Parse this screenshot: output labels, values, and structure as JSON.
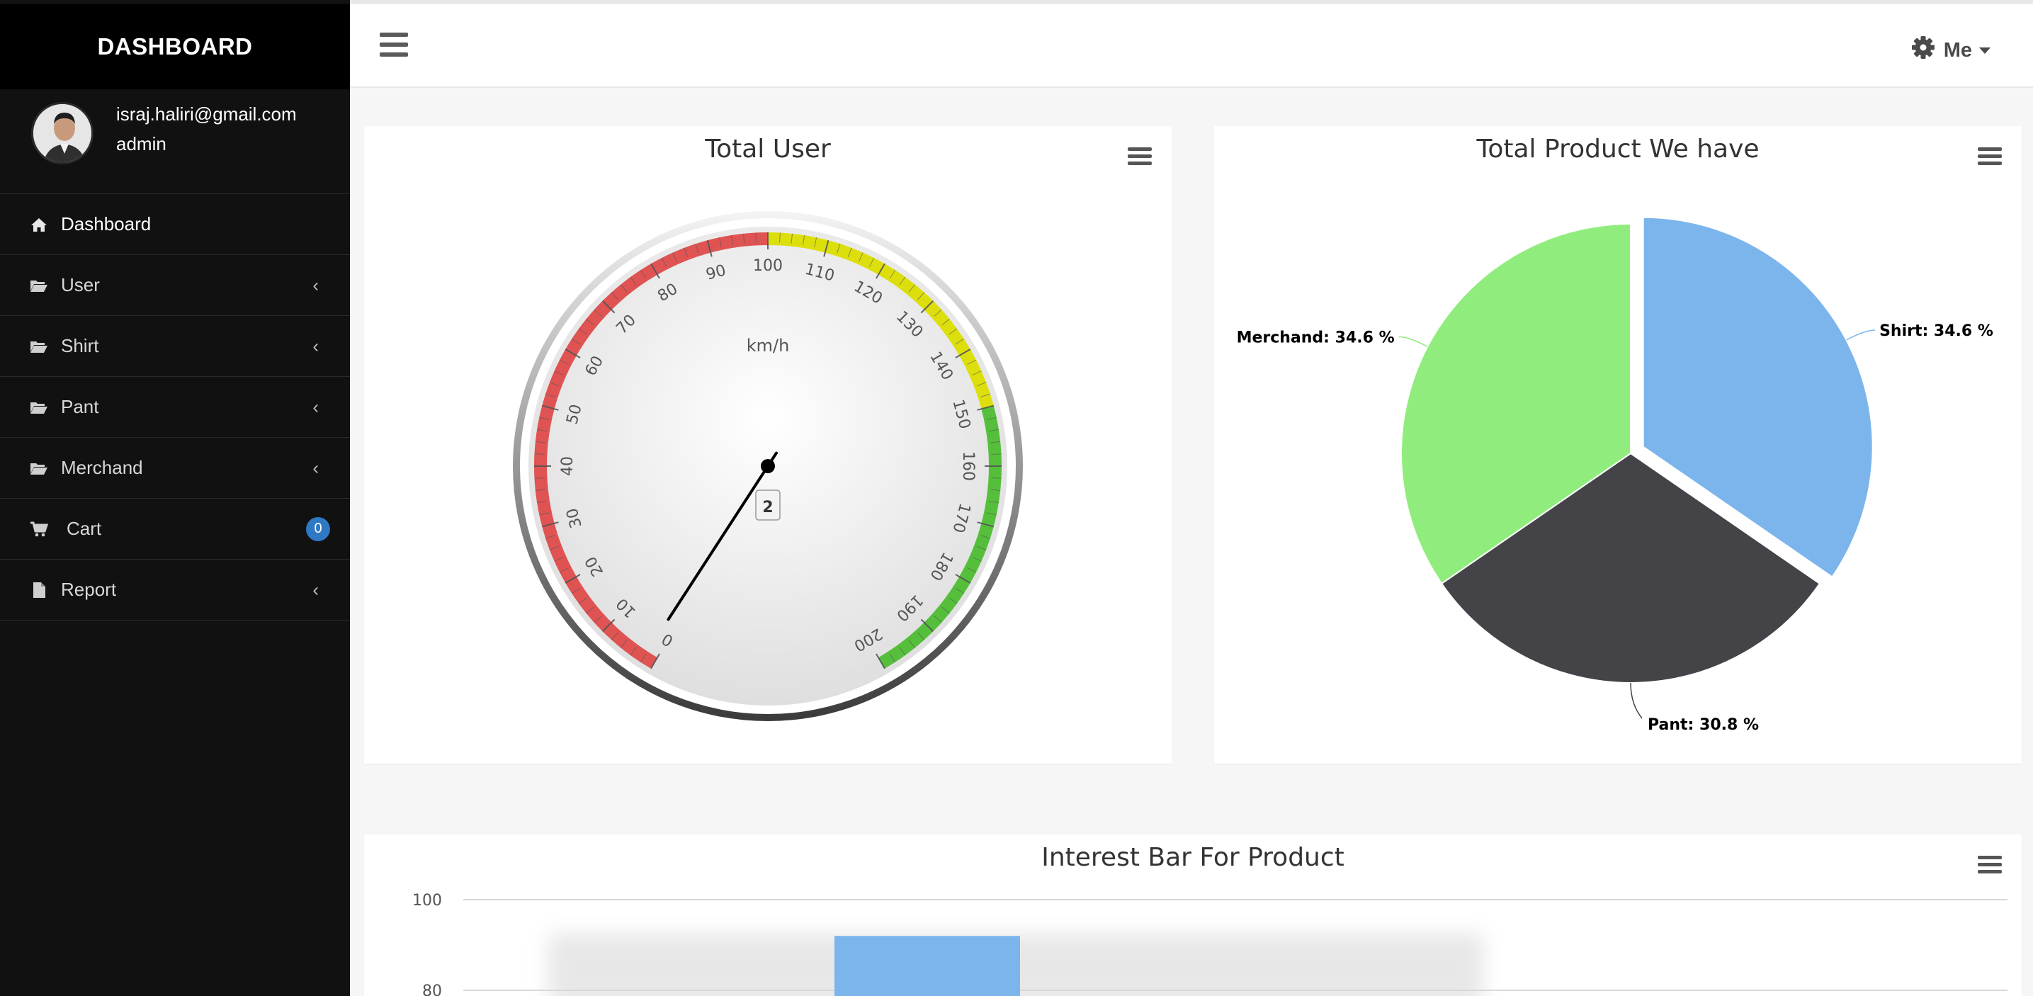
{
  "sidebar": {
    "brand": "DASHBOARD",
    "profile": {
      "email": "israj.haliri@gmail.com",
      "role": "admin"
    },
    "items": [
      {
        "label": "Dashboard",
        "icon": "home-icon",
        "active": true
      },
      {
        "label": "User",
        "icon": "folder-open-icon"
      },
      {
        "label": "Shirt",
        "icon": "folder-open-icon"
      },
      {
        "label": "Pant",
        "icon": "folder-open-icon"
      },
      {
        "label": "Merchand",
        "icon": "folder-open-icon"
      },
      {
        "label": "Cart",
        "icon": "cart-icon",
        "badge": "0"
      },
      {
        "label": "Report",
        "icon": "file-icon"
      }
    ]
  },
  "topbar": {
    "user_label": "Me",
    "menu_icon": "hamburger-icon",
    "settings_icon": "gear-icon"
  },
  "colors": {
    "sidebar_bg": "#111111",
    "brand_bg": "#000000",
    "badge": "#2f78c4",
    "gauge_red": "#df5353",
    "gauge_yellow": "#dddf0d",
    "gauge_green": "#55bf3b",
    "pie_shirt": "#7cb5ec",
    "pie_pant": "#434348",
    "pie_merchand": "#90ed7d",
    "bar": "#7cb5ec"
  },
  "chart_data": [
    {
      "type": "gauge",
      "title": "Total User",
      "unit": "km/h",
      "min": 0,
      "max": 200,
      "ticks": [
        0,
        10,
        20,
        30,
        40,
        50,
        60,
        70,
        80,
        90,
        100,
        110,
        120,
        130,
        140,
        150,
        160,
        170,
        180,
        190,
        200
      ],
      "bands": [
        {
          "from": 0,
          "to": 100,
          "color": "red"
        },
        {
          "from": 100,
          "to": 150,
          "color": "yellow"
        },
        {
          "from": 150,
          "to": 200,
          "color": "green"
        }
      ],
      "value": 2,
      "value_label": "2"
    },
    {
      "type": "pie",
      "title": "Total Product We have",
      "slices": [
        {
          "name": "Shirt",
          "value": 34.6,
          "label": "Shirt: 34.6 %",
          "sliced": true
        },
        {
          "name": "Pant",
          "value": 30.8,
          "label": "Pant: 30.8 %"
        },
        {
          "name": "Merchand",
          "value": 34.6,
          "label": "Merchand: 34.6 %"
        }
      ]
    },
    {
      "type": "bar",
      "title": "Interest Bar For Product",
      "y_ticks": [
        "100",
        "80"
      ],
      "ylim": [
        0,
        100
      ],
      "values": [
        92
      ]
    }
  ]
}
